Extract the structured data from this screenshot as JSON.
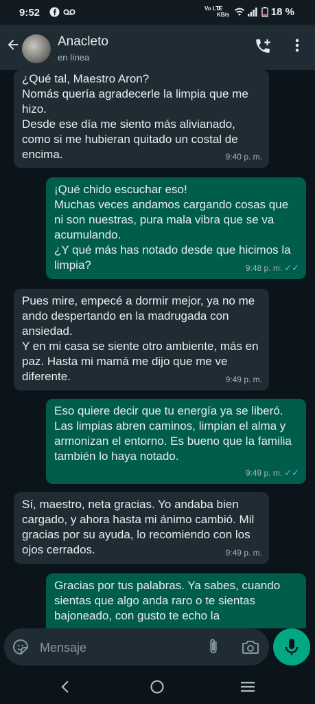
{
  "status_bar": {
    "time": "9:52",
    "network": "Vo LTE",
    "speed": "0 KB/s",
    "battery": "18 %"
  },
  "header": {
    "contact_name": "Anacleto",
    "contact_status": "en línea",
    "back_icon": "arrow-left-icon",
    "call_icon": "add-call-icon",
    "menu_icon": "more-vertical-icon"
  },
  "messages": [
    {
      "direction": "in",
      "text": "¿Qué tal, Maestro Aron?\nNomás quería agradecerle la limpia que me hizo.\nDesde ese día me siento más alivianado, como si me hubieran quitado un costal de encima.",
      "time": "9:40 p. m."
    },
    {
      "direction": "out",
      "text": "¡Qué chido escuchar eso!\nMuchas veces andamos cargando cosas que ni son nuestras, pura mala vibra que se va acumulando.\n¿Y qué más has notado desde que hicimos la limpia?",
      "time": "9:48 p. m.",
      "read": "✓✓"
    },
    {
      "direction": "in",
      "text": "Pues mire, empecé a dormir mejor, ya no me ando despertando en la madrugada con ansiedad.\nY en mi casa se siente otro ambiente, más en paz. Hasta mi mamá me dijo que me ve diferente.",
      "time": "9:49 p. m."
    },
    {
      "direction": "out",
      "text": "Eso quiere decir que tu energía ya se liberó. Las limpias abren caminos, limpian el alma y armonizan el entorno. Es bueno que la familia también lo haya notado.",
      "time": "9:49 p. m.",
      "read": "✓✓"
    },
    {
      "direction": "in",
      "text": "Sí, maestro, neta gracias. Yo andaba bien cargado, y ahora hasta mi ánimo cambió. Mil gracias por su ayuda, lo recomiendo con los ojos cerrados.",
      "time": "9:49 p. m."
    },
    {
      "direction": "out",
      "text": "Gracias por tus palabras. Ya sabes, cuando sientas que algo anda raro o te sientas bajoneado, con gusto te echo la",
      "time": "",
      "read": ""
    }
  ],
  "input": {
    "placeholder": "Mensaje",
    "emoji_icon": "sticker-icon",
    "attach_icon": "paperclip-icon",
    "camera_icon": "camera-icon",
    "mic_icon": "microphone-icon"
  },
  "colors": {
    "background": "#0b141a",
    "incoming_bubble": "#202c33",
    "outgoing_bubble": "#005c4b",
    "read_ticks": "#53bdeb",
    "accent": "#00a884"
  }
}
